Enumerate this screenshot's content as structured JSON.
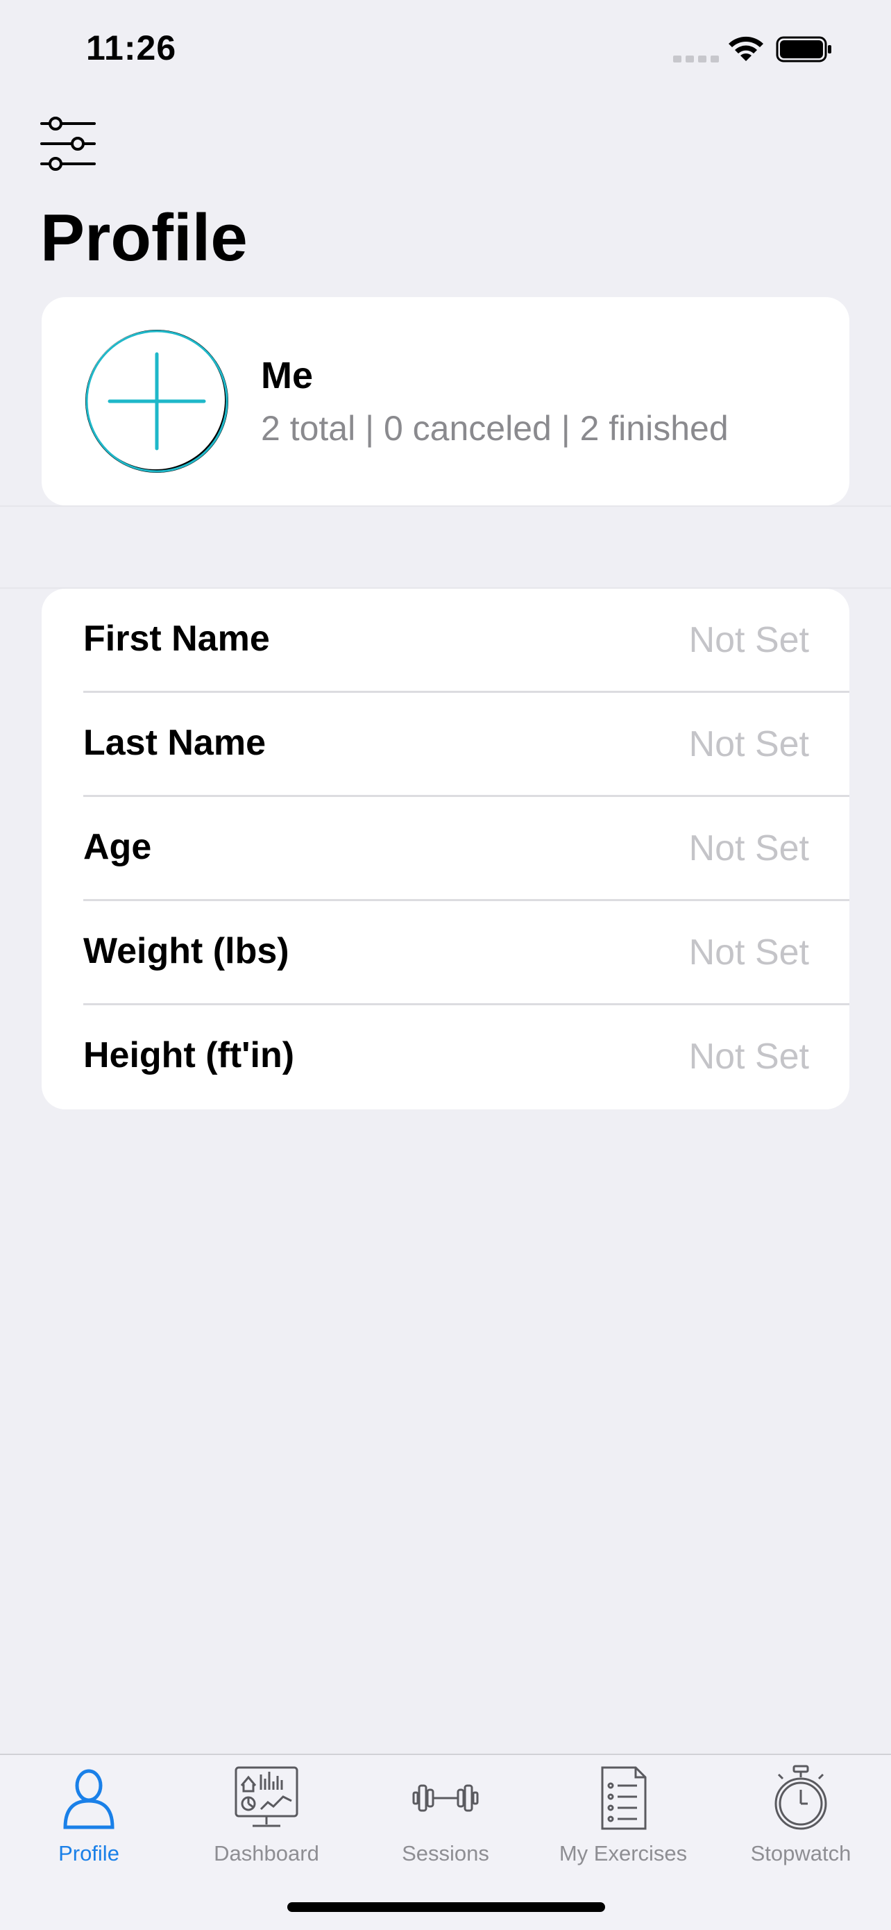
{
  "status_bar": {
    "time": "11:26"
  },
  "header": {
    "title": "Profile"
  },
  "profile_card": {
    "name": "Me",
    "stats": "2 total | 0 canceled | 2 finished"
  },
  "details": [
    {
      "label": "First Name",
      "value": "Not Set"
    },
    {
      "label": "Last Name",
      "value": "Not Set"
    },
    {
      "label": "Age",
      "value": "Not Set"
    },
    {
      "label": "Weight (lbs)",
      "value": "Not Set"
    },
    {
      "label": "Height (ft'in)",
      "value": "Not Set"
    }
  ],
  "tabs": [
    {
      "label": "Profile",
      "icon": "person-icon",
      "active": true
    },
    {
      "label": "Dashboard",
      "icon": "dashboard-icon",
      "active": false
    },
    {
      "label": "Sessions",
      "icon": "dumbbell-icon",
      "active": false
    },
    {
      "label": "My Exercises",
      "icon": "checklist-icon",
      "active": false
    },
    {
      "label": "Stopwatch",
      "icon": "stopwatch-icon",
      "active": false
    }
  ],
  "colors": {
    "accent": "#1a80e8",
    "background": "#efeff4",
    "avatar_plus": "#1fb8c9"
  }
}
